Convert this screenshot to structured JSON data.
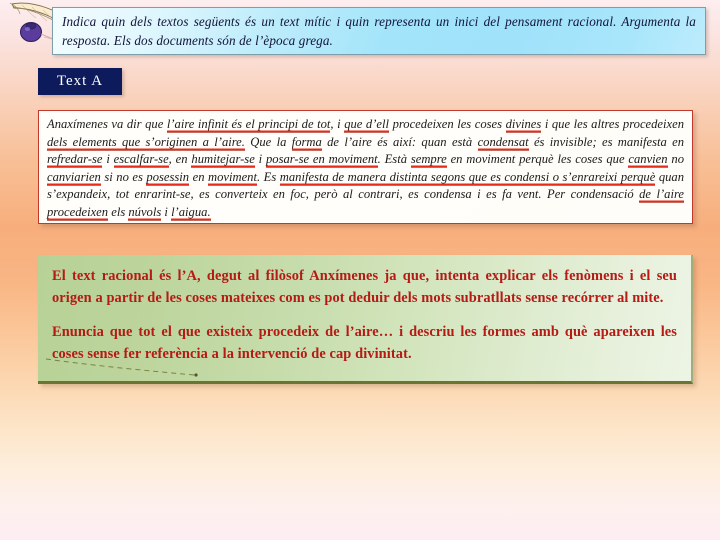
{
  "slide": {
    "background_top_color": "#fdeef0",
    "background_mid_color": "#f7ae7c",
    "background_bottom_color": "#fdeef4"
  },
  "decoration": {
    "quill_icon": "quill-pen-icon",
    "inkwell_icon": "inkwell-icon",
    "squiggle": "dashed-line-decoration"
  },
  "prompt": {
    "accent_color": "#a3e4fa",
    "line1": "Indica quin dels textos següents és un text mític i quin representa un inici del pensament",
    "line2": "racional. Argumenta la resposta. Els dos documents són  de l’època grega."
  },
  "label": {
    "text_a": "Text  A",
    "background_color": "#0d1a5c",
    "text_color": "#ffffff"
  },
  "source": {
    "border_color": "#c0392b",
    "highlight_color": "#e52b1a",
    "segments": [
      {
        "text": "Anaxímenes va dir que ",
        "hl": false
      },
      {
        "text": "l’aire infinit és el principi de tot",
        "hl": true
      },
      {
        "text": ", i ",
        "hl": false
      },
      {
        "text": "que d’ell",
        "hl": true
      },
      {
        "text": " procedeixen les coses ",
        "hl": false
      },
      {
        "text": "divines",
        "hl": true
      },
      {
        "text": " i que les altres procedeixen ",
        "hl": false
      },
      {
        "text": "dels elements que s’originen a l’aire.",
        "hl": true
      },
      {
        "text": " Que la ",
        "hl": false
      },
      {
        "text": "forma",
        "hl": true
      },
      {
        "text": " de l’aire és així: quan està ",
        "hl": false
      },
      {
        "text": "condensat",
        "hl": true
      },
      {
        "text": " és invisible; es manifesta en ",
        "hl": false
      },
      {
        "text": "refredar-se",
        "hl": true
      },
      {
        "text": " i ",
        "hl": false
      },
      {
        "text": "escalfar-se",
        "hl": true
      },
      {
        "text": ", en ",
        "hl": false
      },
      {
        "text": "humitejar-se",
        "hl": true
      },
      {
        "text": " i ",
        "hl": false
      },
      {
        "text": "posar-se  en  moviment",
        "hl": true
      },
      {
        "text": ". Està ",
        "hl": false
      },
      {
        "text": "sempre",
        "hl": true
      },
      {
        "text": " en  moviment perquè les coses que ",
        "hl": false
      },
      {
        "text": "canvien",
        "hl": true
      },
      {
        "text": " no ",
        "hl": false
      },
      {
        "text": "canviarien",
        "hl": true
      },
      {
        "text": " si no es ",
        "hl": false
      },
      {
        "text": "posessin",
        "hl": true
      },
      {
        "text": " en ",
        "hl": false
      },
      {
        "text": "moviment",
        "hl": true
      },
      {
        "text": ". Es ",
        "hl": false
      },
      {
        "text": "manifesta de manera distinta segons que es condensi o s’enrareixi perquè",
        "hl": true
      },
      {
        "text": " quan s’expandeix, tot enrarint-se, es converteix en foc, però al contrari, es condensa i es fa vent. Per condensació ",
        "hl": false
      },
      {
        "text": "de l’aire procedeixen",
        "hl": true
      },
      {
        "text": " els ",
        "hl": false
      },
      {
        "text": "núvols",
        "hl": true
      },
      {
        "text": " i ",
        "hl": false
      },
      {
        "text": "l’aigua.",
        "hl": true
      }
    ],
    "plain_text": "Anaxímenes va dir que l’aire infinit és el principi de tot, i que d’ell procedeixen les coses divines i que les altres procedeixen dels elements que s’originen a l’aire. Que la forma de l’aire és així: quan està condensat és invisible; es manifesta en refredar-se i escalfar-se, en humitejar-se i posar-se en moviment. Està sempre en moviment perquè les coses que canvien no canviarien si no es posessin en moviment. Es manifesta de manera distinta segons que es condensi o s’enrareixi perquè quan s’expandeix, tot enrarint-se, es converteix en foc, però al contrari, es condensa i es fa vent. Per condensació de l’aire procedeixen els núvols i l’aigua."
  },
  "answer": {
    "text_color": "#b51a15",
    "background_color": "#c6dcab",
    "border_color": "#6b7533",
    "paragraph1": "El text racional és l’A, degut al filòsof Anxímenes ja que, intenta explicar els fenòmens i el seu origen a partir de les coses mateixes com es pot deduir dels mots subratllats sense recórrer al mite.",
    "paragraph2": "Enuncia que tot el que existeix procedeix de l’aire… i descriu les formes amb què apareixen les coses sense fer referència a la intervenció de cap divinitat."
  }
}
